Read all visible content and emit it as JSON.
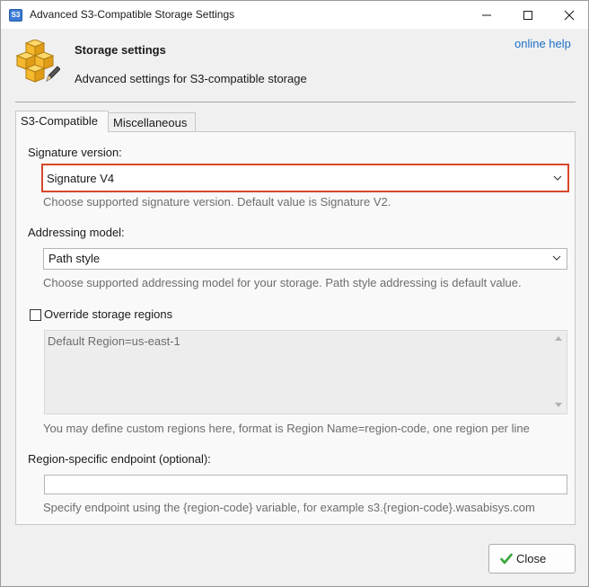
{
  "window": {
    "app_icon_text": "S3",
    "title": "Advanced S3-Compatible Storage Settings"
  },
  "header": {
    "title": "Storage settings",
    "subtitle": "Advanced settings for S3-compatible storage",
    "help_link": "online help"
  },
  "tabs": [
    {
      "label": "S3-Compatible",
      "active": true
    },
    {
      "label": "Miscellaneous",
      "active": false
    }
  ],
  "signature": {
    "label": "Signature version:",
    "value": "Signature V4",
    "hint": "Choose supported signature version. Default value is Signature V2."
  },
  "addressing": {
    "label": "Addressing model:",
    "value": "Path style",
    "hint": "Choose supported addressing model for your storage. Path style addressing is default value."
  },
  "regions": {
    "checkbox_label": "Override storage regions",
    "checked": false,
    "textarea_value": "Default Region=us-east-1",
    "hint": "You may define custom regions here, format is Region Name=region-code, one region per line"
  },
  "endpoint": {
    "label": "Region-specific endpoint (optional):",
    "value": "",
    "hint": "Specify endpoint using the {region-code} variable, for example s3.{region-code}.wasabisys.com"
  },
  "footer": {
    "close_label": "Close"
  },
  "colors": {
    "link": "#1e6fc7",
    "focus_border": "#d6472a",
    "icon_box": "#f5b82e",
    "check_green": "#3aa53a"
  },
  "icons": [
    "storage-boxes-icon",
    "pencil-icon",
    "chevron-down-icon",
    "checkmark-icon",
    "minimize-icon",
    "maximize-icon",
    "close-icon"
  ]
}
